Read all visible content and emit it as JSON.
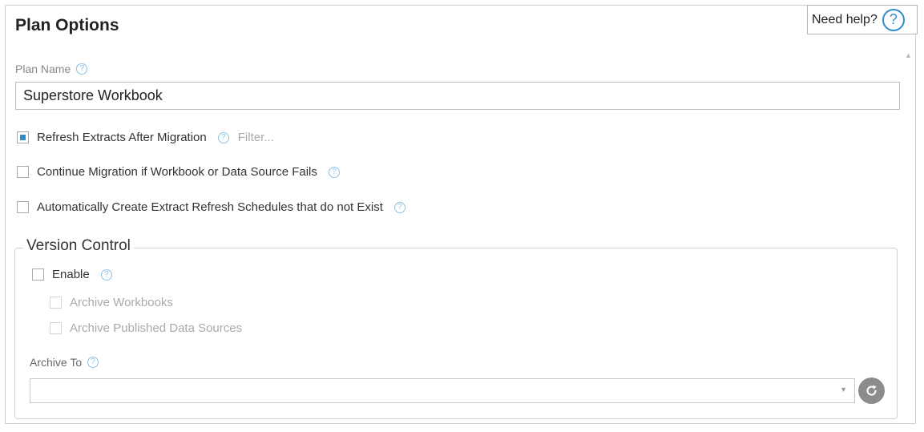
{
  "header": {
    "title": "Plan Options",
    "help_label": "Need help?",
    "help_icon": "question-circle-icon"
  },
  "plan_name": {
    "label": "Plan Name",
    "value": "Superstore Workbook"
  },
  "options": [
    {
      "label": "Refresh Extracts After Migration",
      "checked": true,
      "link": "Filter..."
    },
    {
      "label": "Continue Migration if Workbook or Data Source Fails",
      "checked": false
    },
    {
      "label": "Automatically Create Extract Refresh Schedules that do not Exist",
      "checked": false
    }
  ],
  "version_control": {
    "legend": "Version Control",
    "enable_label": "Enable",
    "enable_checked": false,
    "sub_options": [
      {
        "label": "Archive Workbooks",
        "checked": false,
        "disabled": true
      },
      {
        "label": "Archive Published Data Sources",
        "checked": false,
        "disabled": true
      }
    ],
    "archive_to_label": "Archive To",
    "archive_to_value": ""
  },
  "icons": {
    "help": "question-circle-icon",
    "refresh": "refresh-icon",
    "dropdown": "caret-down-icon"
  },
  "colors": {
    "accent": "#2f8ec9",
    "refresh_button": "#8c8c8c"
  }
}
